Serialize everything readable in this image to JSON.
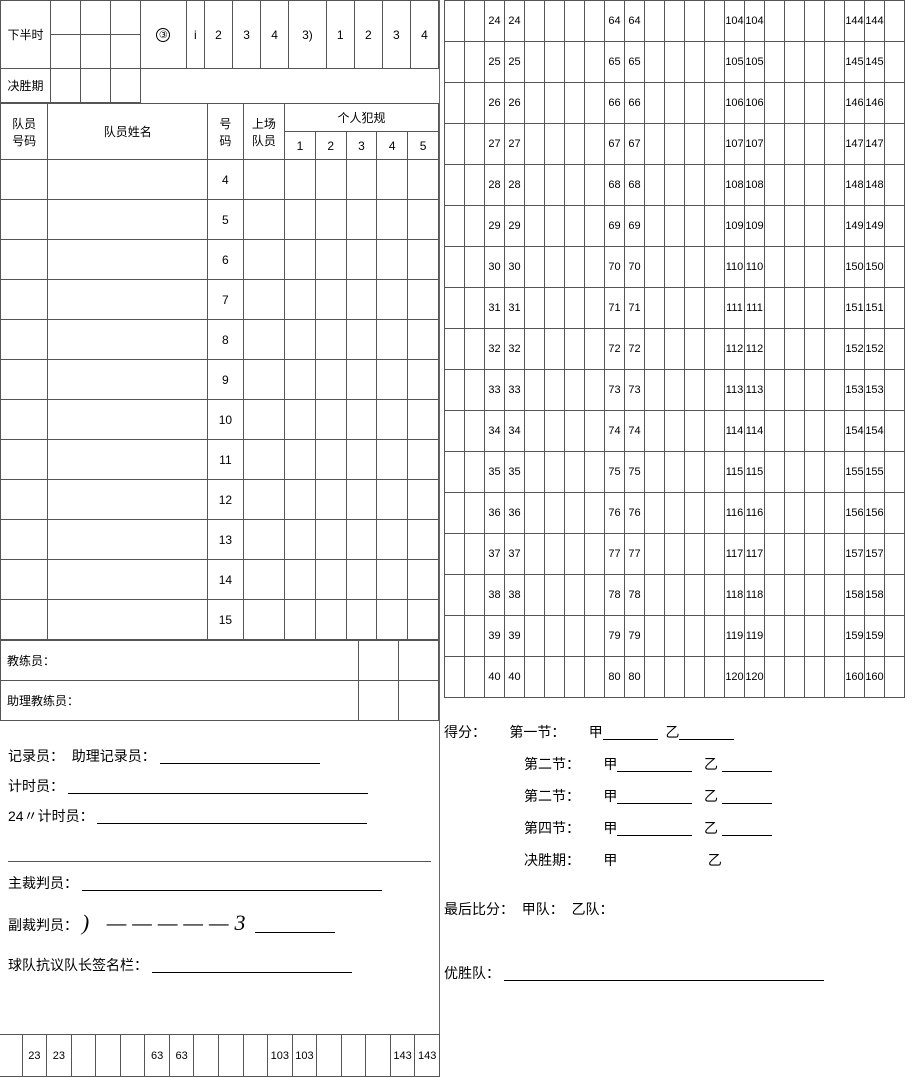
{
  "top_rows": {
    "row1_label": "下半时",
    "row1_seq": [
      "③",
      "i",
      "2",
      "3",
      "4",
      "3)",
      "1",
      "2",
      "3",
      "4"
    ],
    "row2_label": "决胜期"
  },
  "roster": {
    "col_team_no": "队员\n号码",
    "col_name": "队员姓名",
    "col_no": "号\n码",
    "col_onfield": "上场\n队员",
    "col_foul_header": "个人犯规",
    "foul_nums": [
      "1",
      "2",
      "3",
      "4",
      "5"
    ],
    "numbers": [
      "4",
      "5",
      "6",
      "7",
      "8",
      "9",
      "10",
      "11",
      "12",
      "13",
      "14",
      "15"
    ]
  },
  "coach": {
    "head": "教练员：",
    "assistant": "助理教练员：",
    "scorer": "记录员：",
    "assistant_scorer": "助理记录员：",
    "timer": "计时员：",
    "shot_clock": "24〃计时员：",
    "chief_ref": "主裁判员：",
    "assistant_ref": "副裁判员：",
    "ref_scribble": ") —————3",
    "protest": "球队抗议队长签名栏："
  },
  "bottom_strip": {
    "vals": [
      "23",
      "23",
      "",
      "",
      "",
      "63",
      "63",
      "",
      "",
      "",
      "103",
      "103",
      "",
      "",
      "",
      "143",
      "143"
    ]
  },
  "score_rows": [
    [
      "24",
      "24",
      "",
      "64",
      "64",
      "",
      "104",
      "104",
      "",
      "144",
      "144"
    ],
    [
      "25",
      "25",
      "",
      "65",
      "65",
      "",
      "105",
      "105",
      "",
      "145",
      "145"
    ],
    [
      "26",
      "26",
      "",
      "66",
      "66",
      "",
      "106",
      "106",
      "",
      "146",
      "146"
    ],
    [
      "27",
      "27",
      "",
      "67",
      "67",
      "",
      "107",
      "107",
      "",
      "147",
      "147"
    ],
    [
      "28",
      "28",
      "",
      "68",
      "68",
      "",
      "108",
      "108",
      "",
      "148",
      "148"
    ],
    [
      "29",
      "29",
      "",
      "69",
      "69",
      "",
      "109",
      "109",
      "",
      "149",
      "149"
    ],
    [
      "30",
      "30",
      "",
      "70",
      "70",
      "",
      "110",
      "110",
      "",
      "150",
      "150"
    ],
    [
      "31",
      "31",
      "",
      "71",
      "71",
      "",
      "111",
      "111",
      "",
      "151",
      "151"
    ],
    [
      "32",
      "32",
      "",
      "72",
      "72",
      "",
      "112",
      "112",
      "",
      "152",
      "152"
    ],
    [
      "33",
      "33",
      "",
      "73",
      "73",
      "",
      "113",
      "113",
      "",
      "153",
      "153"
    ],
    [
      "34",
      "34",
      "",
      "74",
      "74",
      "",
      "114",
      "114",
      "",
      "154",
      "154"
    ],
    [
      "35",
      "35",
      "",
      "75",
      "75",
      "",
      "115",
      "115",
      "",
      "155",
      "155"
    ],
    [
      "36",
      "36",
      "",
      "76",
      "76",
      "",
      "116",
      "116",
      "",
      "156",
      "156"
    ],
    [
      "37",
      "37",
      "",
      "77",
      "77",
      "",
      "117",
      "117",
      "",
      "157",
      "157"
    ],
    [
      "38",
      "38",
      "",
      "78",
      "78",
      "",
      "118",
      "118",
      "",
      "158",
      "158"
    ],
    [
      "39",
      "39",
      "",
      "79",
      "79",
      "",
      "119",
      "119",
      "",
      "159",
      "159"
    ],
    [
      "40",
      "40",
      "",
      "80",
      "80",
      "",
      "120",
      "120",
      "",
      "160",
      "160"
    ]
  ],
  "summary": {
    "score_label": "得分：",
    "periods": [
      "第一节：",
      "第二节：",
      "第二节：",
      "第四节：",
      "决胜期："
    ],
    "team_a": "甲",
    "team_b": "乙",
    "final_score": "最后比分：",
    "team_a_label": "甲队：",
    "team_b_label": "乙队：",
    "winner": "优胜队："
  }
}
